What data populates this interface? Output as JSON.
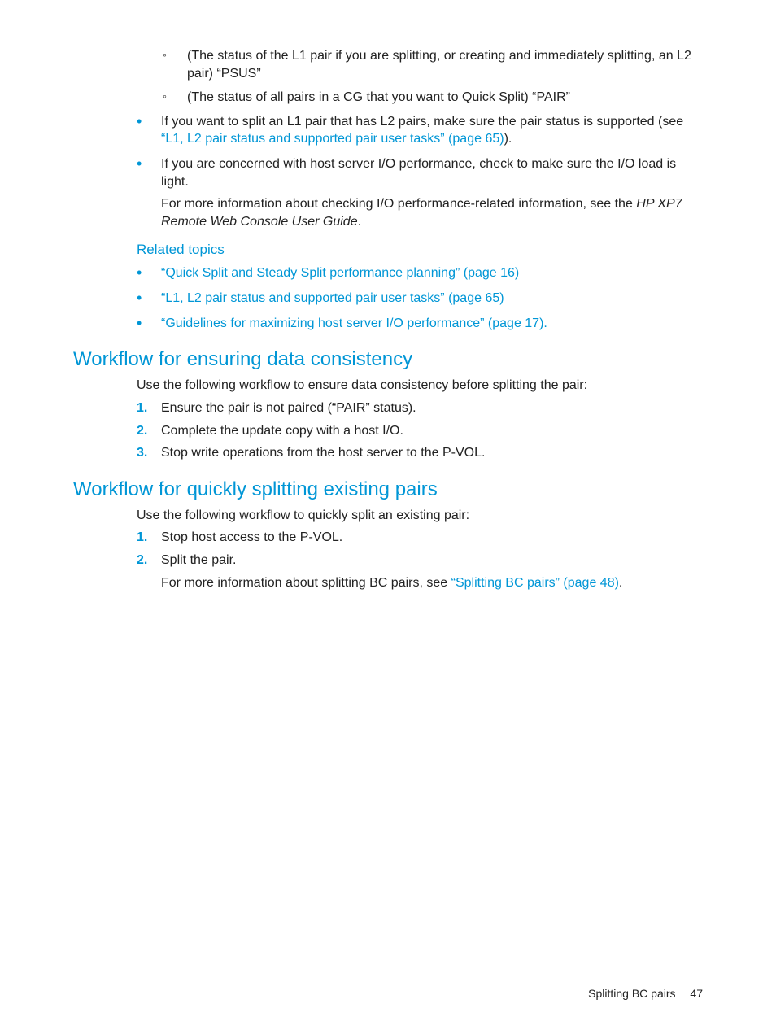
{
  "sublist": [
    "(The status of the L1 pair if you are splitting, or creating and immediately splitting, an L2 pair) “PSUS”",
    "(The status of all pairs in a CG that you want to Quick Split) “PAIR”"
  ],
  "bullets1": [
    {
      "pre": "If you want to split an L1 pair that has L2 pairs, make sure the pair status is supported (see ",
      "link": "“L1, L2 pair status and supported pair user tasks” (page 65)",
      "post": ")."
    },
    {
      "pre": "If you are concerned with host server I/O performance, check to make sure the I/O load is light.",
      "link": "",
      "post": "",
      "sub1": "For more information about checking I/O performance-related information, see the ",
      "subItalic": "HP XP7 Remote Web Console User Guide",
      "sub2": "."
    }
  ],
  "related": {
    "heading": "Related topics",
    "items": [
      "“Quick Split and Steady Split performance planning” (page 16)",
      "“L1, L2 pair status and supported pair user tasks” (page 65)",
      "“Guidelines for maximizing host server I/O performance” (page 17)."
    ]
  },
  "section1": {
    "heading": "Workflow for ensuring data consistency",
    "intro": "Use the following workflow to ensure data consistency before splitting the pair:",
    "steps": [
      "Ensure the pair is not paired (“PAIR” status).",
      "Complete the update copy with a host I/O.",
      "Stop write operations from the host server to the P-VOL."
    ]
  },
  "section2": {
    "heading": "Workflow for quickly splitting existing pairs",
    "intro": "Use the following workflow to quickly split an existing pair:",
    "steps": [
      {
        "text": "Stop host access to the P-VOL."
      },
      {
        "text": "Split the pair.",
        "sub1": "For more information about splitting BC pairs, see ",
        "link": "“Splitting BC pairs” (page 48)",
        "sub2": "."
      }
    ]
  },
  "footer": {
    "label": "Splitting BC pairs",
    "page": "47"
  }
}
